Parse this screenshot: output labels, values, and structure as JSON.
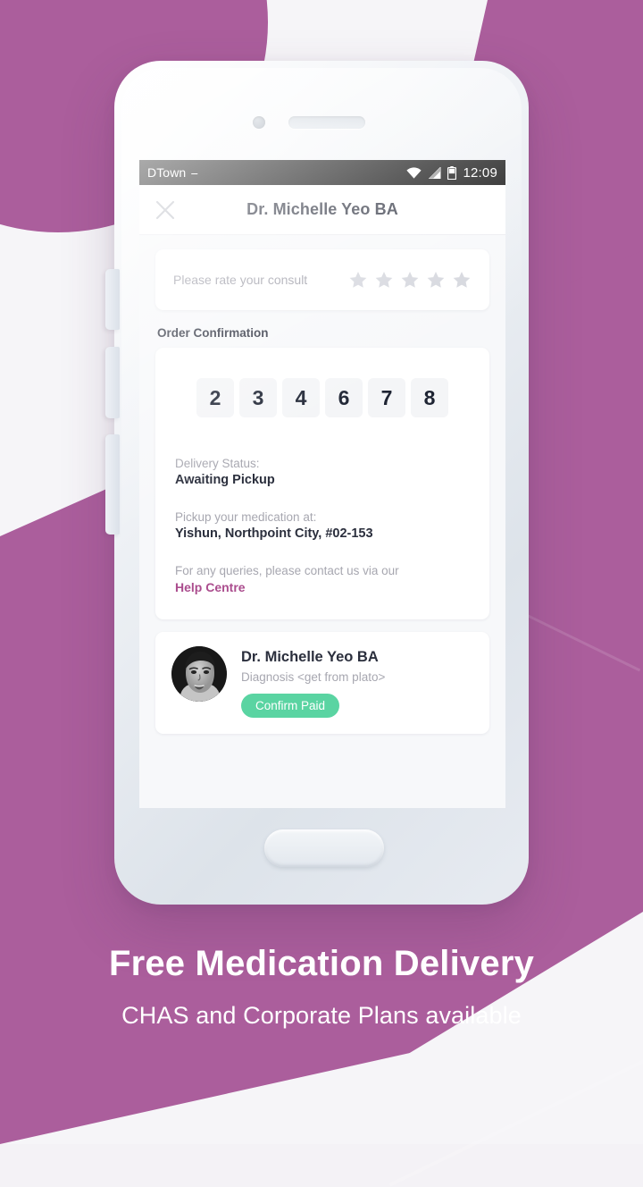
{
  "background": {
    "accent_color": "#ab5e9c",
    "page_color": "#f6f5f8"
  },
  "phone": {
    "camera_icon": "camera-dot",
    "speaker_icon": "earpiece-speaker",
    "home_button": "home-button"
  },
  "statusbar": {
    "carrier": "DTown",
    "carrier_icon": "network-badge-icon",
    "wifi_icon": "wifi-icon",
    "signal_icon": "cellular-signal-icon",
    "battery_icon": "battery-half-icon",
    "time": "12:09"
  },
  "appbar": {
    "close_icon": "close-icon",
    "title": "Dr. Michelle Yeo BA"
  },
  "rating": {
    "label": "Please rate your consult",
    "star_count": 5,
    "filled": 0,
    "star_icon": "star-icon",
    "star_color": "#d3d5dc"
  },
  "order": {
    "section_title": "Order Confirmation",
    "code_digits": [
      "2",
      "3",
      "4",
      "6",
      "7",
      "8"
    ],
    "delivery_status_label": "Delivery Status:",
    "delivery_status_value": "Awaiting Pickup",
    "pickup_label": "Pickup your medication at:",
    "pickup_value": "Yishun, Northpoint City, #02-153",
    "queries_text": "For any queries, please contact us via our",
    "help_link": "Help Centre",
    "help_link_color": "#ab4d8e"
  },
  "doctor_card": {
    "avatar_icon": "doctor-avatar-photo",
    "name": "Dr. Michelle Yeo BA",
    "diagnosis": "Diagnosis <get from plato>",
    "button_label": "Confirm Paid",
    "button_color": "#5ad4a2"
  },
  "promo": {
    "headline": "Free Medication Delivery",
    "subline": "CHAS and Corporate Plans available"
  }
}
